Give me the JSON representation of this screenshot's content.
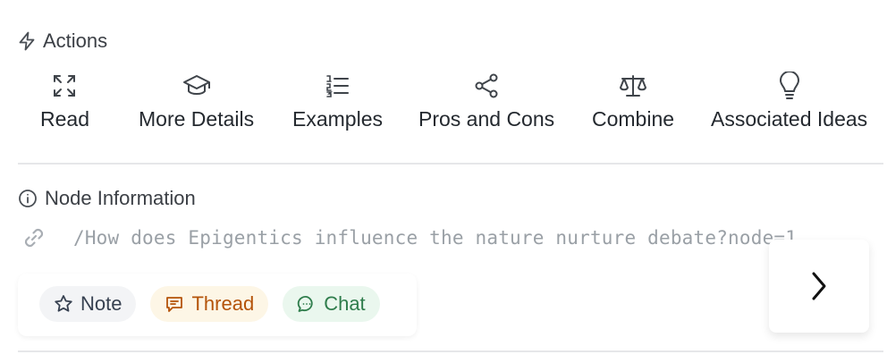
{
  "actions_section": {
    "title": "Actions",
    "icon": "lightning-icon",
    "items": [
      {
        "label": "Read",
        "icon": "expand-icon"
      },
      {
        "label": "More Details",
        "icon": "graduation-cap-icon"
      },
      {
        "label": "Examples",
        "icon": "list-ordered-icon"
      },
      {
        "label": "Pros and Cons",
        "icon": "share-nodes-icon"
      },
      {
        "label": "Combine",
        "icon": "scale-icon"
      },
      {
        "label": "Associated Ideas",
        "icon": "lightbulb-icon"
      }
    ]
  },
  "node_info": {
    "title": "Node Information",
    "icon": "info-icon",
    "link_icon": "link-icon",
    "path": "/How does Epigentics influence the nature nurture debate?node=1",
    "chips": {
      "note": "Note",
      "thread": "Thread",
      "chat": "Chat"
    }
  },
  "next_button": {
    "icon": "chevron-right-icon"
  },
  "colors": {
    "thread_text": "#b45309",
    "thread_bg": "#fdf6e6",
    "chat_text": "#2f7d4c",
    "chat_bg": "#eaf7ee",
    "note_bg": "#f3f4f6",
    "path_text": "#9aa0a6"
  }
}
